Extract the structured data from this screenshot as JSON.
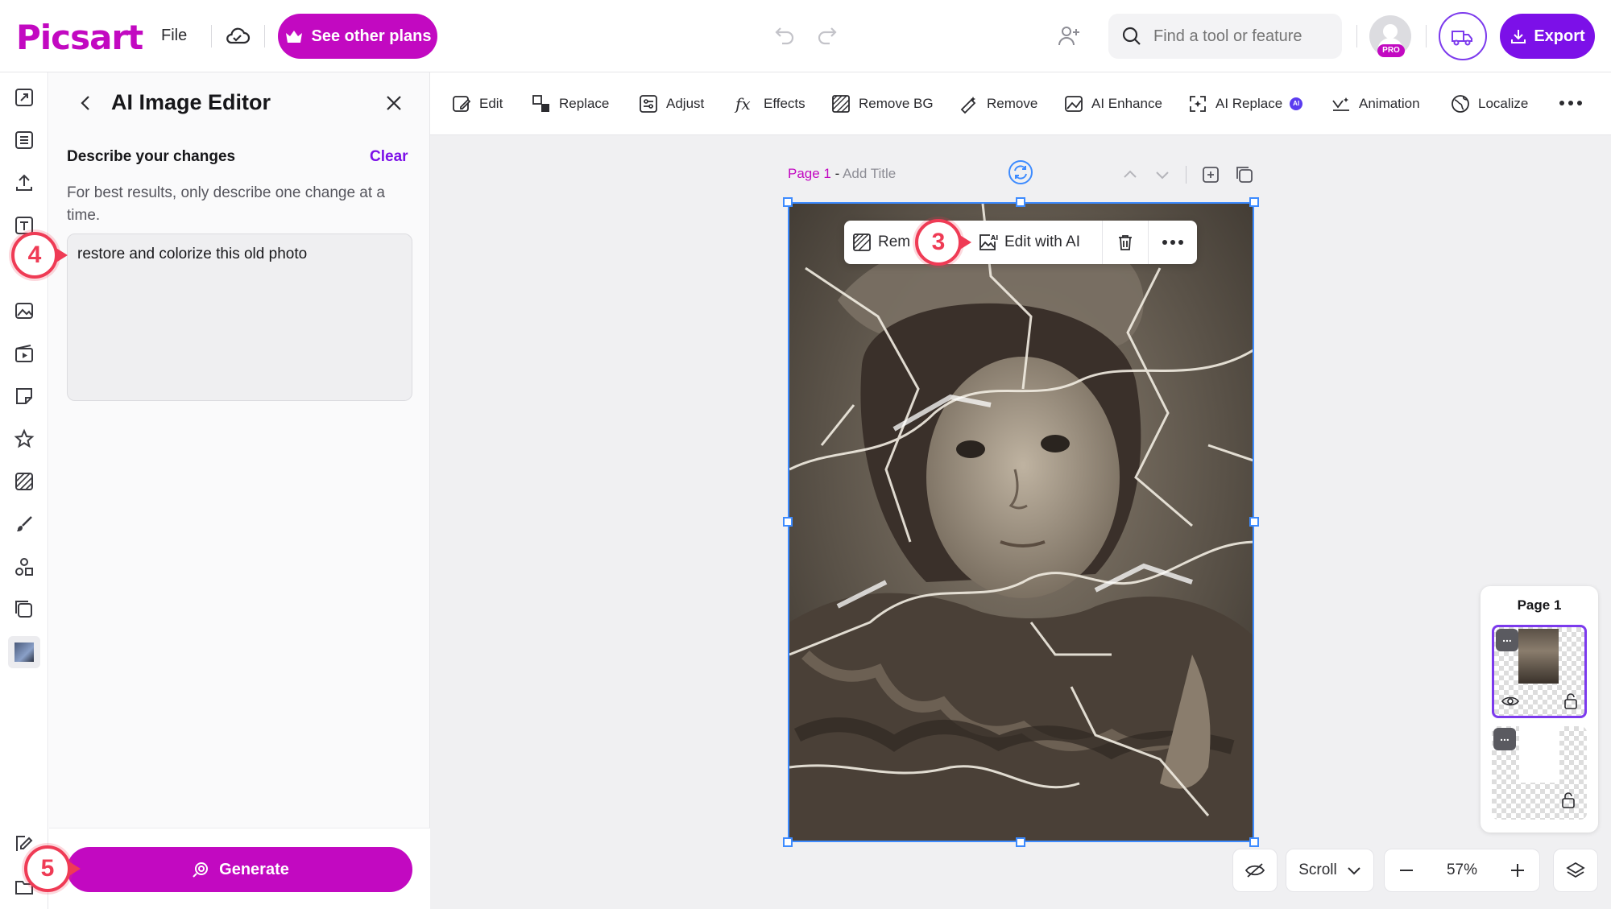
{
  "app": {
    "logo_text": "Picsart",
    "file_menu": "File",
    "plans_button": "See other plans",
    "export_button": "Export",
    "pro_badge": "PRO"
  },
  "search": {
    "placeholder": "Find a tool or feature"
  },
  "toolbar": {
    "items": [
      {
        "label": "Edit",
        "icon": "edit-icon"
      },
      {
        "label": "Replace",
        "icon": "replace-icon"
      },
      {
        "label": "Adjust",
        "icon": "adjust-icon"
      },
      {
        "label": "Effects",
        "icon": "fx-icon"
      },
      {
        "label": "Remove BG",
        "icon": "remove-bg-icon"
      },
      {
        "label": "Remove",
        "icon": "eraser-icon"
      },
      {
        "label": "AI Enhance",
        "icon": "enhance-icon"
      },
      {
        "label": "AI Replace",
        "icon": "ai-replace-icon",
        "badge": "AI"
      },
      {
        "label": "Animation",
        "icon": "animation-icon"
      },
      {
        "label": "Localize",
        "icon": "globe-icon"
      }
    ]
  },
  "panel": {
    "title": "AI Image Editor",
    "describe_label": "Describe your changes",
    "clear_label": "Clear",
    "hint": "For best results, only describe one change at a time.",
    "prompt_value": "restore and colorize this old photo",
    "generate_label": "Generate"
  },
  "canvas": {
    "page_number": "Page 1",
    "page_separator": " - ",
    "page_title_placeholder": "Add Title",
    "context_toolbar": {
      "remove_bg_partial": "Rem",
      "edit_with_ai": "Edit with AI"
    }
  },
  "pages_panel": {
    "title": "Page 1"
  },
  "bottom_controls": {
    "view_mode": "Scroll",
    "zoom": "57%"
  },
  "steps": [
    "3",
    "4",
    "5"
  ],
  "colors": {
    "brand": "#c209c1",
    "export": "#7c10e8",
    "accent_purple": "#7c3aed",
    "selection": "#3d8bff",
    "step_marker": "#ef3b55"
  }
}
